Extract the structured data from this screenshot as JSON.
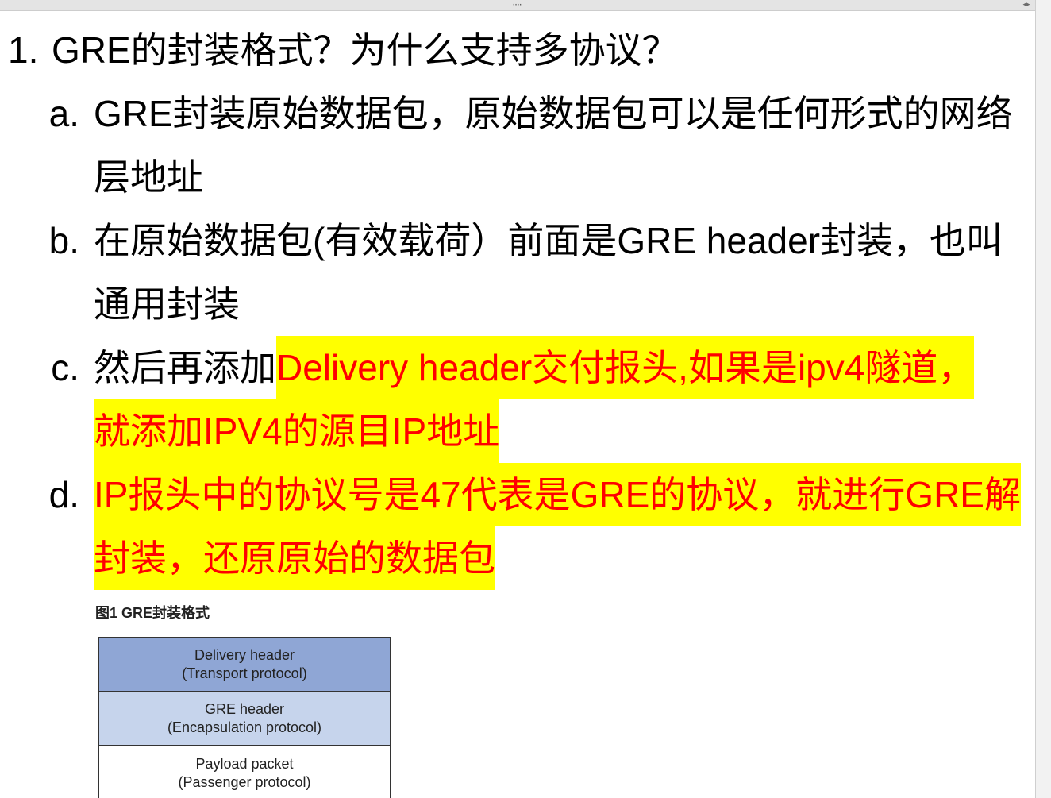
{
  "note_container": {
    "grip_glyph": "····",
    "arrows_glyph": "◂▸",
    "grip_icon": "drag-handle-icon",
    "arrows_icon": "resize-arrows-icon"
  },
  "colors": {
    "text": "#000000",
    "highlight_bg": "#ffff00",
    "highlight_text": "#ff0000",
    "diagram_border": "#333333"
  },
  "outline": {
    "number": "1.",
    "title": "GRE的封装格式？为什么支持多协议？",
    "items": [
      {
        "marker": "a.",
        "lines": [
          [
            {
              "text": "GRE封装原始数据包，原始数据包可以是任何形式的网络",
              "highlight": false
            }
          ],
          [
            {
              "text": "层地址",
              "highlight": false
            }
          ]
        ]
      },
      {
        "marker": "b.",
        "lines": [
          [
            {
              "text": "在原始数据包(有效载荷）前面是GRE header封装，也叫",
              "highlight": false
            }
          ],
          [
            {
              "text": "通用封装",
              "highlight": false
            }
          ]
        ]
      },
      {
        "marker": "c.",
        "lines": [
          [
            {
              "text": "然后再添加",
              "highlight": false
            },
            {
              "text": "Delivery header交付报头,如果是ipv4隧道，",
              "highlight": true
            }
          ],
          [
            {
              "text": "就添加IPV4的源目IP地址",
              "highlight": true
            }
          ]
        ]
      },
      {
        "marker": "d.",
        "lines": [
          [
            {
              "text": "IP报头中的协议号是47代表是GRE的协议，就进行GRE解",
              "highlight": true
            }
          ],
          [
            {
              "text": "封装，还原原始的数据包",
              "highlight": true
            }
          ]
        ]
      }
    ]
  },
  "figure": {
    "caption": "图1 GRE封装格式",
    "layers": [
      {
        "name": "Delivery header",
        "protocol": "(Transport protocol)",
        "fill": "#8fa6d5"
      },
      {
        "name": "GRE header",
        "protocol": "(Encapsulation protocol)",
        "fill": "#c6d4ec"
      },
      {
        "name": "Payload packet",
        "protocol": "(Passenger protocol)",
        "fill": "#ffffff"
      }
    ]
  }
}
